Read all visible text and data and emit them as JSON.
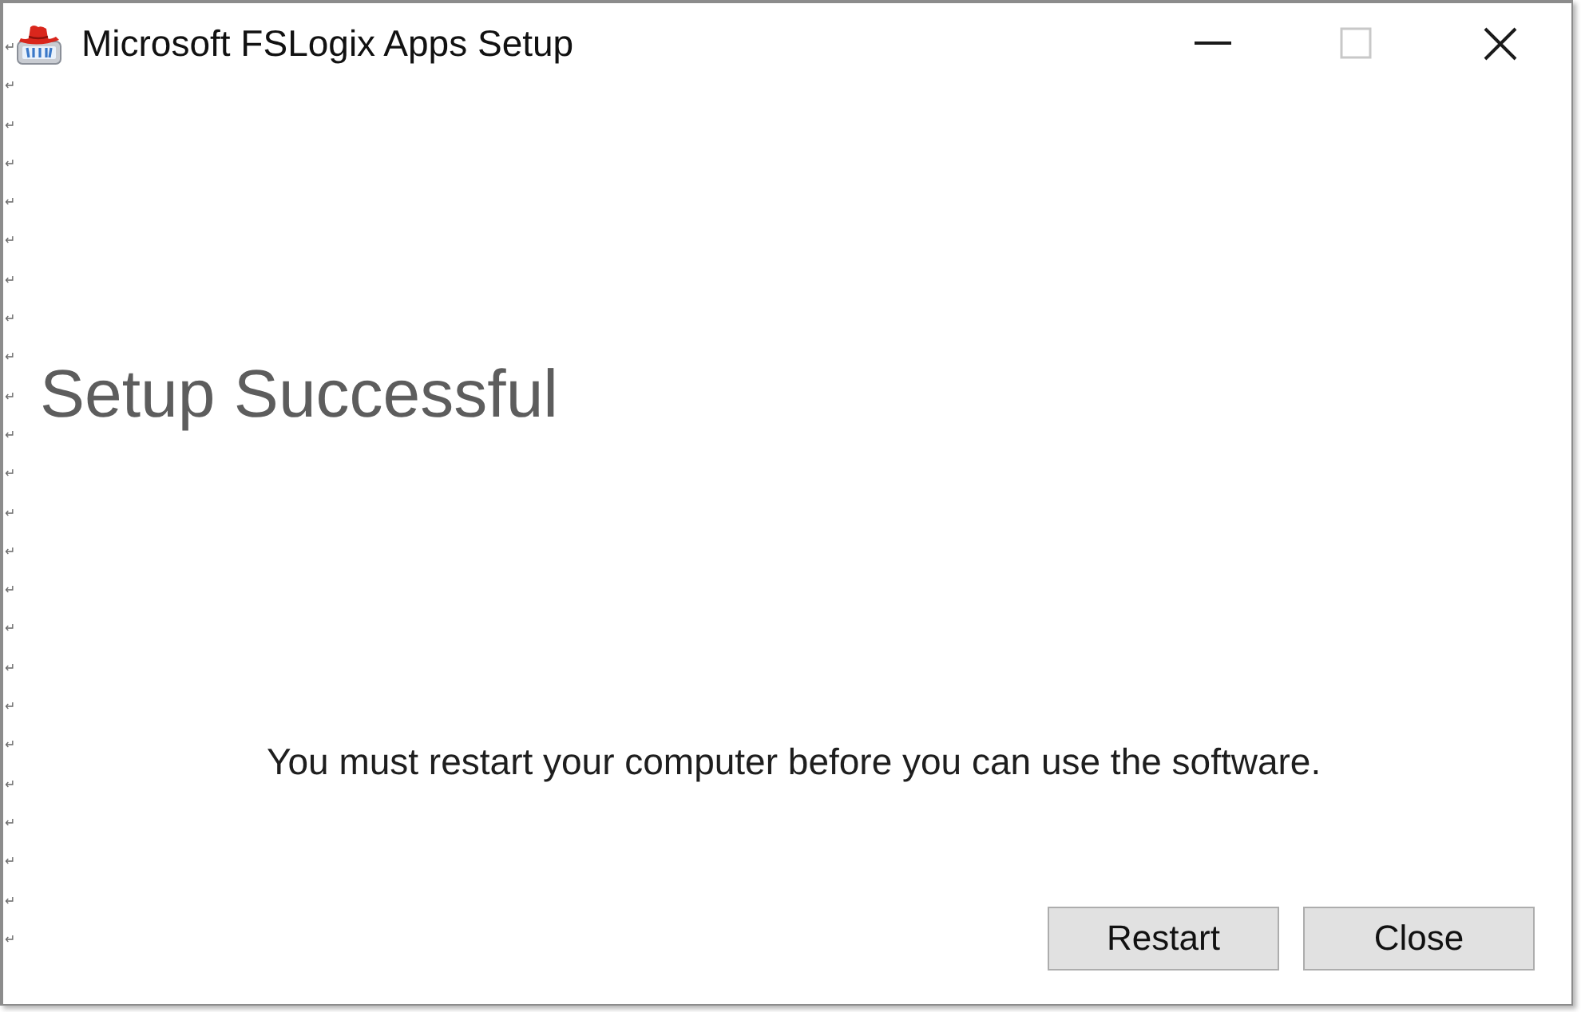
{
  "paragraph_marks": [
    "↵",
    "↵",
    "↵",
    "↵",
    "↵",
    "↵",
    "↵",
    "↵",
    "↵",
    "↵",
    "↵",
    "↵",
    "↵",
    "↵",
    "↵",
    "↵",
    "↵",
    "↵",
    "↵",
    "↵",
    "↵",
    "↵",
    "↵",
    "↵"
  ],
  "window": {
    "title": "Microsoft FSLogix Apps Setup",
    "controls": [
      {
        "kind": "minimize",
        "disabled": false
      },
      {
        "kind": "maximize",
        "disabled": true
      },
      {
        "kind": "close",
        "disabled": false
      }
    ]
  },
  "heading": "Setup Successful",
  "message": "You must restart your computer before you can use the software.",
  "buttons": [
    {
      "label": "Restart"
    },
    {
      "label": "Close"
    }
  ]
}
